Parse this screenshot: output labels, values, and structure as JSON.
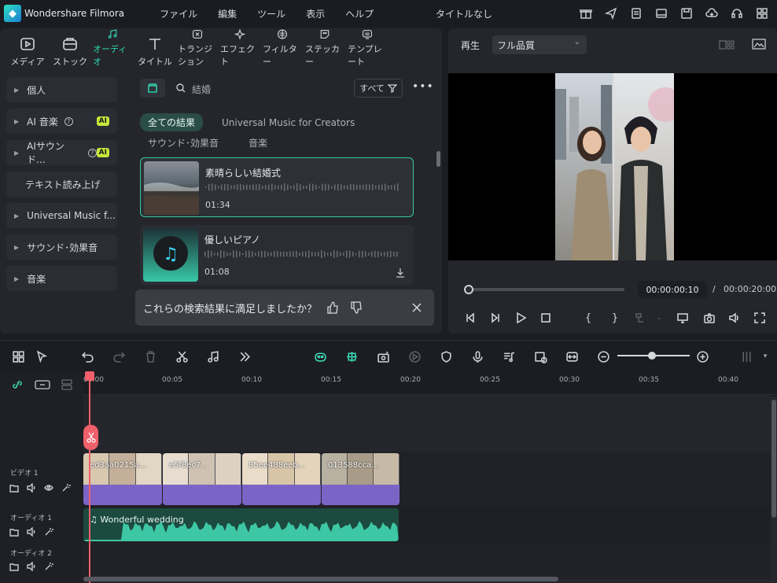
{
  "app": {
    "name": "Wondershare Filmora",
    "doc_title": "タイトルなし"
  },
  "menu": [
    "ファイル",
    "編集",
    "ツール",
    "表示",
    "ヘルプ"
  ],
  "toolbar": [
    "メディア",
    "ストック",
    "オーディオ",
    "タイトル",
    "トランジション",
    "エフェクト",
    "フィルター",
    "ステッカー",
    "テンプレート"
  ],
  "sidebar": {
    "personal": "個人",
    "ai_music": "AI 音楽",
    "ai_sound": "AIサウンド...",
    "ai_badge": "AI",
    "tts": "テキスト読み上げ",
    "universal": "Universal Music f...",
    "sfx": "サウンド･効果音",
    "music": "音楽"
  },
  "search": {
    "query": "結婚",
    "filter_label": "すべて"
  },
  "tabs": {
    "all_results": "全ての結果",
    "universal": "Universal Music for Creators",
    "sfx": "サウンド･効果音",
    "music": "音楽"
  },
  "results": [
    {
      "title": "素晴らしい結婚式",
      "duration": "01:34"
    },
    {
      "title": "優しいピアノ",
      "duration": "01:08"
    }
  ],
  "feedback": {
    "text": "これらの検索結果に満足しましたか？"
  },
  "preview": {
    "label": "再生",
    "quality": "フル品質",
    "timecode": "00:00:00:10",
    "separator": "/",
    "total": "00:00:20:00",
    "progress_fraction": 0.02
  },
  "ruler": [
    "00:00",
    "00:05",
    "00:10",
    "00:15",
    "00:20",
    "00:25",
    "00:30",
    "00:35",
    "00:40"
  ],
  "tracks": {
    "video1": "ビデオ 1",
    "audio1": "オーディオ 1",
    "audio2": "オーディオ 2"
  },
  "clips": [
    "ed3aa0215a...",
    "e5f8ec7...",
    "85ee488eeb...",
    "013588cca..."
  ],
  "audio_clip": {
    "name": "Wonderful wedding"
  },
  "colors": {
    "accent": "#2fd9b5",
    "playhead": "#f0606a",
    "video_clip": "#7c64c7",
    "audio_clip": "#1c4a3f"
  }
}
